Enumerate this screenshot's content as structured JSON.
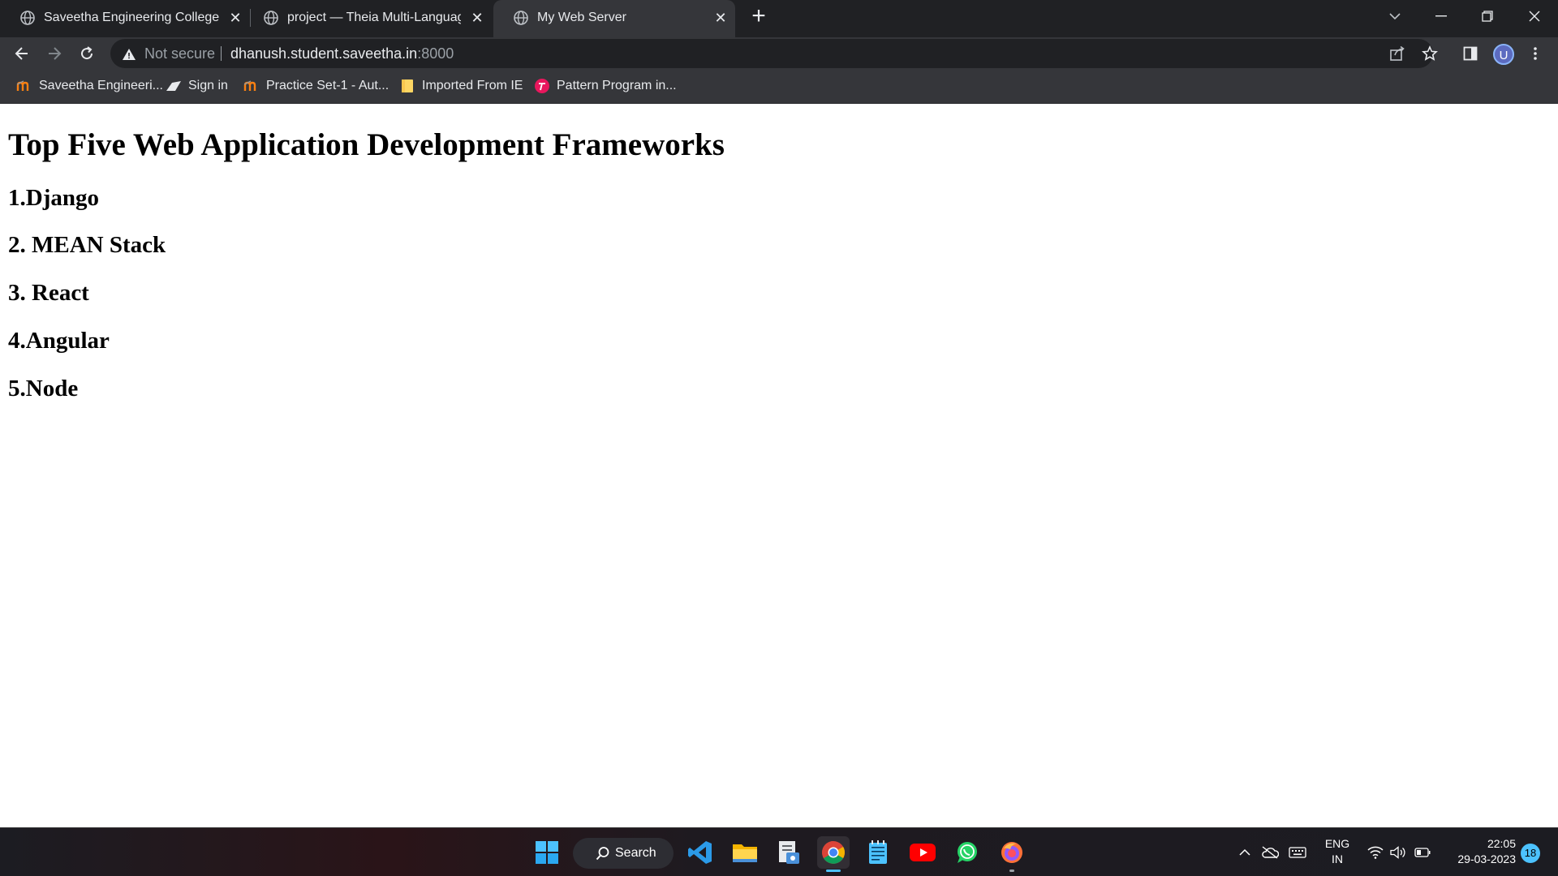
{
  "browser": {
    "tabs": [
      {
        "title": "Saveetha Engineering College",
        "active": false
      },
      {
        "title": "project — Theia Multi-Language",
        "active": false
      },
      {
        "title": "My Web Server",
        "active": true
      }
    ],
    "address": {
      "security_label": "Not secure",
      "host": "dhanush.student.saveetha.in",
      "port": ":8000"
    },
    "profile_initial": "U",
    "bookmarks": [
      {
        "label": "Saveetha Engineeri...",
        "icon": "moodle-icon"
      },
      {
        "label": "Sign in",
        "icon": "sign-in-icon"
      },
      {
        "label": "Practice Set-1 - Aut...",
        "icon": "moodle-icon"
      },
      {
        "label": "Imported From IE",
        "icon": "folder-icon"
      },
      {
        "label": "Pattern Program in...",
        "icon": "pattern-icon"
      }
    ]
  },
  "page": {
    "heading": "Top Five Web Application Development Frameworks",
    "items": [
      "1.Django",
      "2. MEAN Stack",
      "3. React",
      "4.Angular",
      "5.Node"
    ]
  },
  "taskbar": {
    "search_label": "Search",
    "language": "ENG",
    "region": "IN",
    "time": "22:05",
    "date": "29-03-2023",
    "notification_count": "18",
    "colors": {
      "accent": "#4cc2ff",
      "chrome_dark": "#202124",
      "chrome_toolbar": "#35363a"
    }
  }
}
